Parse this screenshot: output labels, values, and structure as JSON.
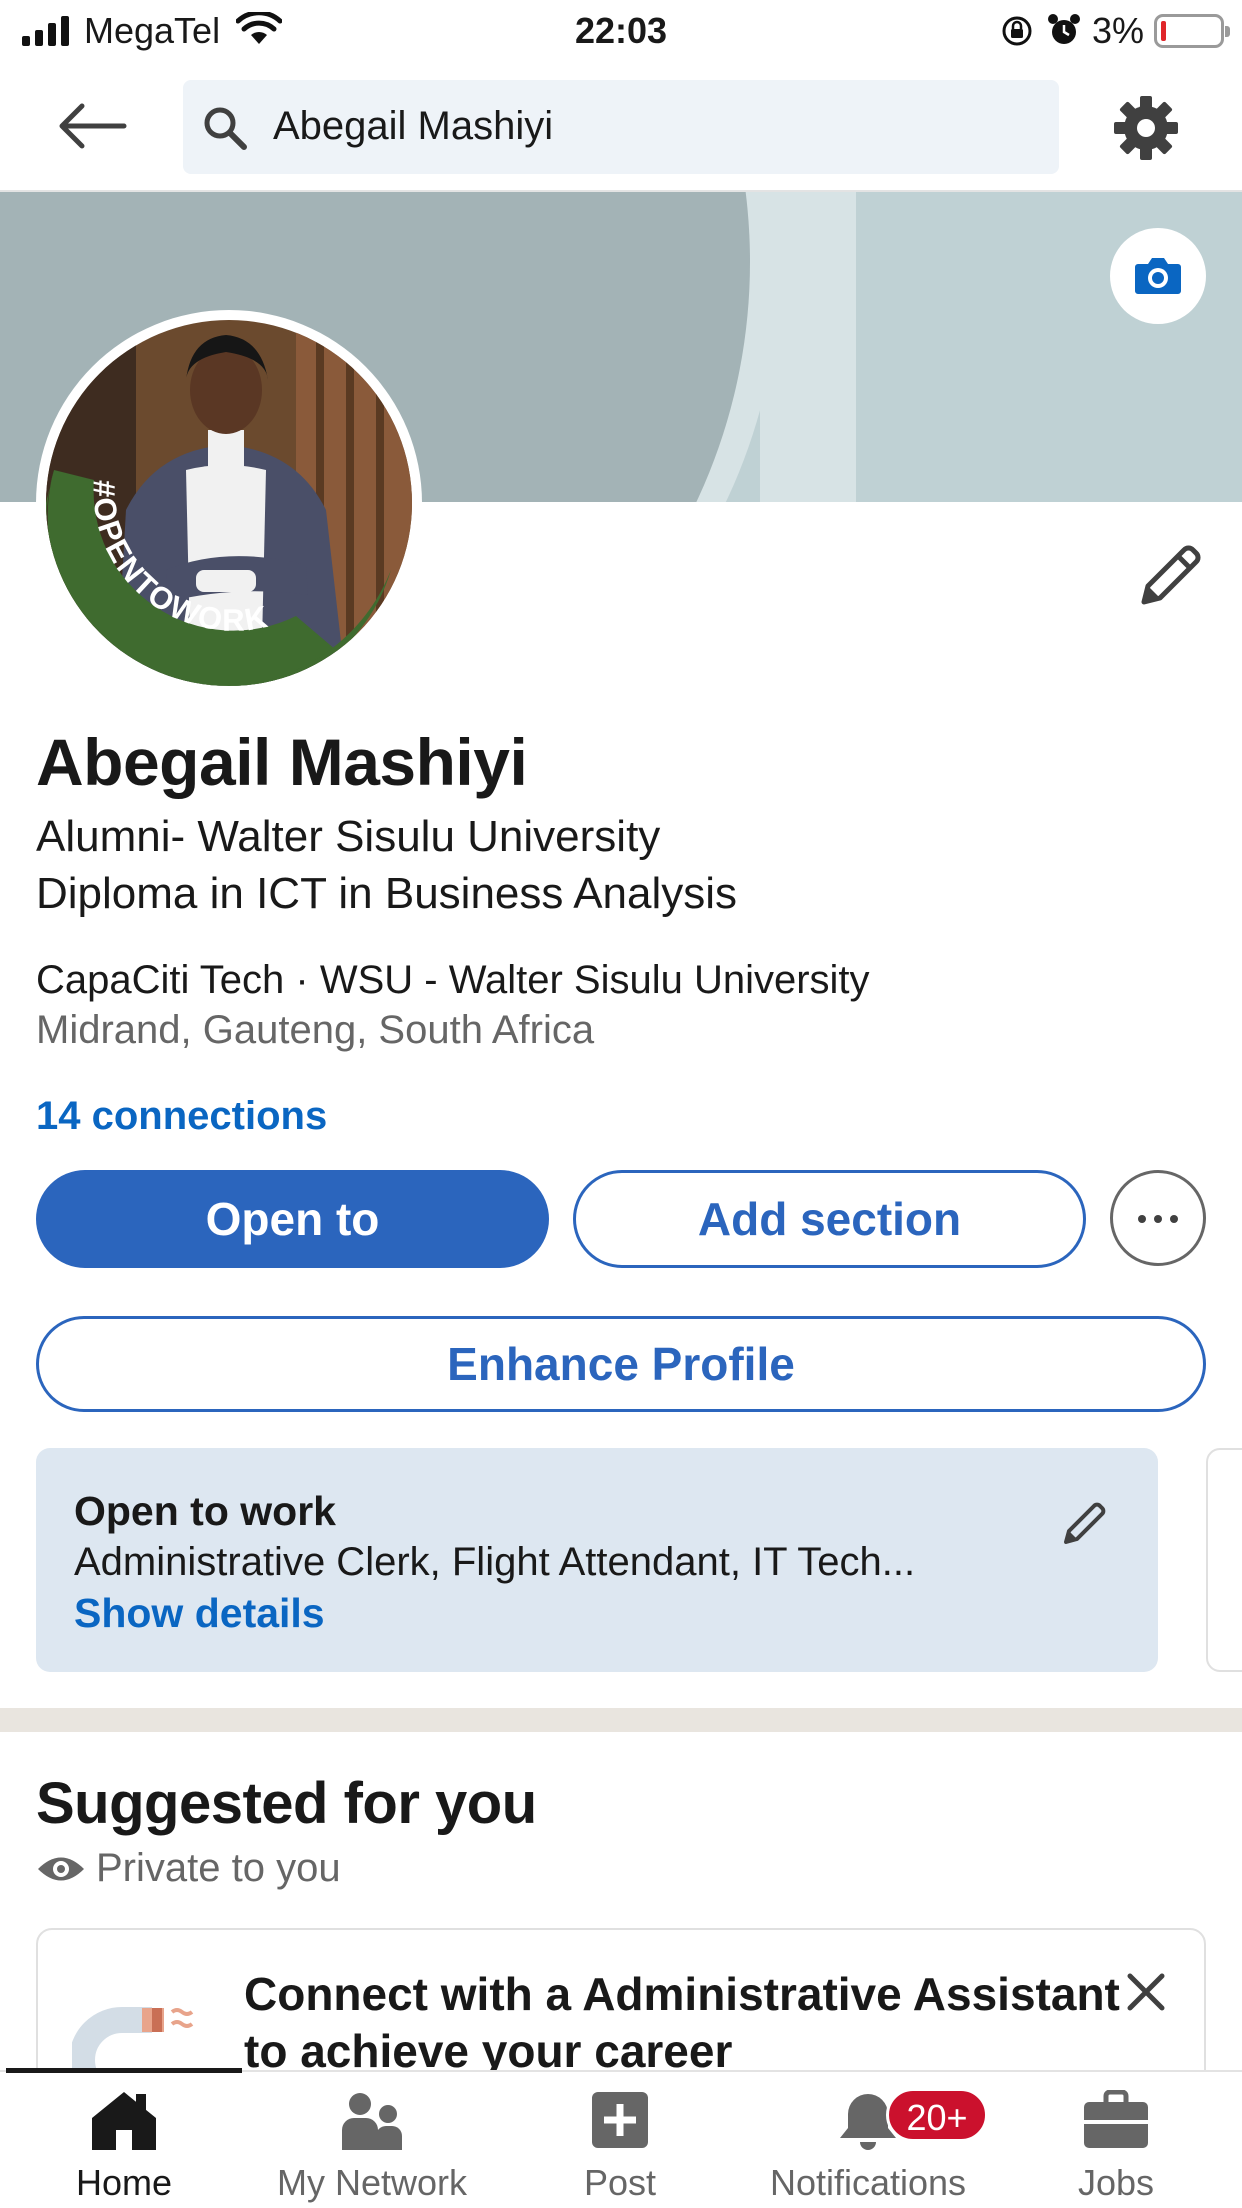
{
  "status_bar": {
    "carrier": "MegaTel",
    "time": "22:03",
    "battery_percent": "3%",
    "battery_level": 0.03,
    "icons": [
      "signal-icon",
      "wifi-icon",
      "rotation-lock-icon",
      "alarm-icon",
      "battery-icon"
    ]
  },
  "top_bar": {
    "search_value": "Abegail Mashiyi",
    "icons": [
      "back-arrow-icon",
      "search-icon",
      "gear-icon"
    ]
  },
  "profile": {
    "avatar_frame_text": "#OPENTOWORK",
    "name": "Abegail Mashiyi",
    "headline_line1": "Alumni- Walter Sisulu University",
    "headline_line2": "Diploma in ICT in Business Analysis",
    "company": "CapaCiti Tech · WSU - Walter Sisulu University",
    "location": "Midrand, Gauteng, South Africa",
    "connections": "14 connections"
  },
  "actions": {
    "open_to": "Open to",
    "add_section": "Add section",
    "enhance_profile": "Enhance Profile"
  },
  "open_to_work": {
    "title": "Open to work",
    "roles": "Administrative Clerk, Flight Attendant, IT Tech...",
    "show_details": "Show details"
  },
  "suggested": {
    "title": "Suggested for you",
    "privacy": "Private to you",
    "card_text": "Connect with a Administrative Assistant to achieve your career"
  },
  "bottom_nav": {
    "items": [
      {
        "label": "Home",
        "icon": "home-icon"
      },
      {
        "label": "My Network",
        "icon": "network-icon"
      },
      {
        "label": "Post",
        "icon": "post-icon"
      },
      {
        "label": "Notifications",
        "icon": "bell-icon"
      },
      {
        "label": "Jobs",
        "icon": "briefcase-icon"
      }
    ],
    "notifications_badge": "20+"
  },
  "colors": {
    "brand_blue": "#0a66c2",
    "button_blue": "#2b65bd",
    "otw_card_bg": "#dde7f1",
    "badge_red": "#cb112d",
    "opentowork_green": "#3f6b2f"
  }
}
